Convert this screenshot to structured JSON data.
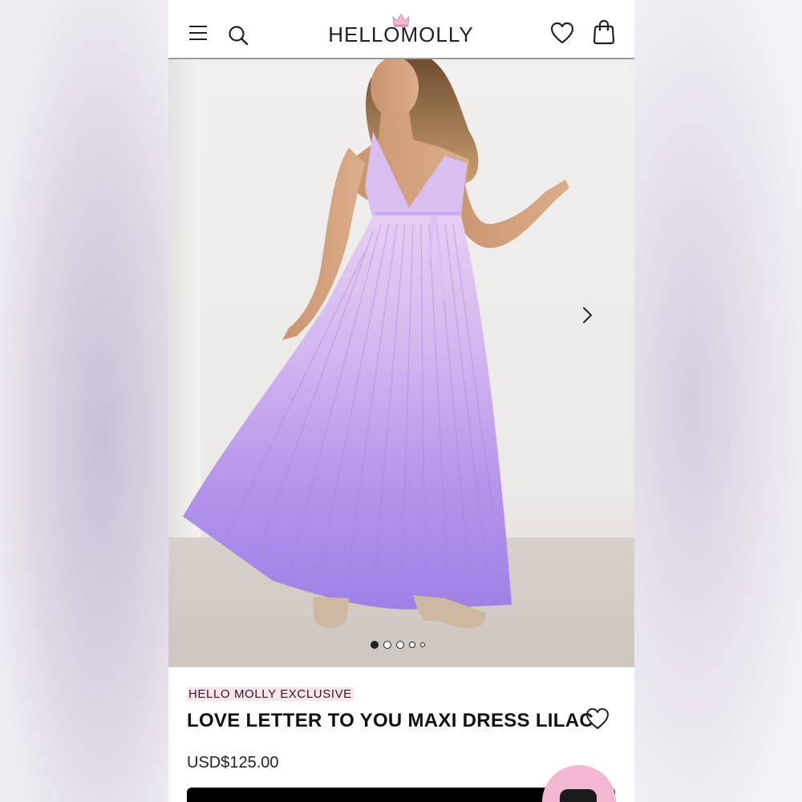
{
  "header": {
    "brand": "HELLOMOLLY",
    "icons": {
      "menu": "menu-icon",
      "search": "search-icon",
      "wishlist": "heart-icon",
      "bag": "shopping-bag-icon",
      "crown": "crown-icon"
    }
  },
  "gallery": {
    "image_alt": "model-in-lilac-pleated-maxi-dress",
    "total_images": 5,
    "active_index": 0
  },
  "product": {
    "eyebrow": "HELLO MOLLY EXCLUSIVE",
    "title": "LOVE LETTER TO YOU MAXI DRESS LILAC",
    "price": "USD$125.00"
  },
  "colors": {
    "accent_pink": "#f2b8d3",
    "eyebrow_highlight": "#fde3ef",
    "dress_lilac": "#b79be8",
    "text": "#111111"
  }
}
